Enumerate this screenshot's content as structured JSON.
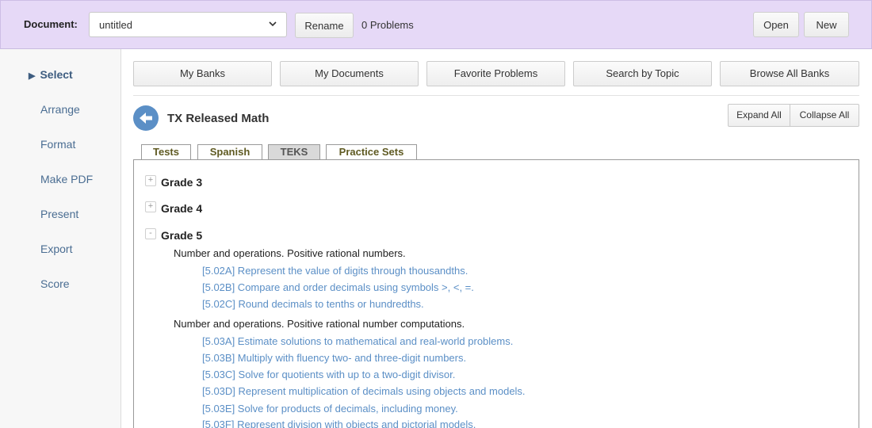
{
  "header": {
    "document_label": "Document:",
    "document_value": "untitled",
    "rename_label": "Rename",
    "problems_count": "0 Problems",
    "open_label": "Open",
    "new_label": "New"
  },
  "sidebar": {
    "items": [
      {
        "label": "Select",
        "active": true
      },
      {
        "label": "Arrange"
      },
      {
        "label": "Format"
      },
      {
        "label": "Make PDF"
      },
      {
        "label": "Present"
      },
      {
        "label": "Export"
      },
      {
        "label": "Score"
      }
    ]
  },
  "top_tabs": [
    "My Banks",
    "My Documents",
    "Favorite Problems",
    "Search by Topic",
    "Browse All Banks"
  ],
  "bank": {
    "title": "TX Released Math",
    "expand_all": "Expand All",
    "collapse_all": "Collapse All"
  },
  "sub_tabs": [
    {
      "label": "Tests"
    },
    {
      "label": "Spanish"
    },
    {
      "label": "TEKS",
      "active": true
    },
    {
      "label": "Practice Sets"
    }
  ],
  "tree": {
    "grades": [
      {
        "label": "Grade 3",
        "toggle": "+"
      },
      {
        "label": "Grade 4",
        "toggle": "+"
      },
      {
        "label": "Grade 5",
        "toggle": "-"
      }
    ],
    "categories": [
      {
        "label": "Number and operations. Positive rational numbers.",
        "items": [
          "[5.02A] Represent the value of digits through thousandths.",
          "[5.02B] Compare and order decimals using symbols >, <, =.",
          "[5.02C] Round decimals to tenths or hundredths."
        ]
      },
      {
        "label": "Number and operations. Positive rational number computations.",
        "items": [
          "[5.03A] Estimate solutions to mathematical and real-world problems.",
          "[5.03B] Multiply with fluency two- and three-digit numbers.",
          "[5.03C] Solve for quotients with up to a two-digit divisor.",
          "[5.03D] Represent multiplication of decimals using objects and models.",
          "[5.03E] Solve for products of decimals, including money.",
          "[5.03F] Represent division with objects and pictorial models."
        ]
      }
    ]
  },
  "colors": {
    "header_bg": "#e6d9f7",
    "link": "#5b8fc6",
    "nav_text": "#4a6d92"
  }
}
